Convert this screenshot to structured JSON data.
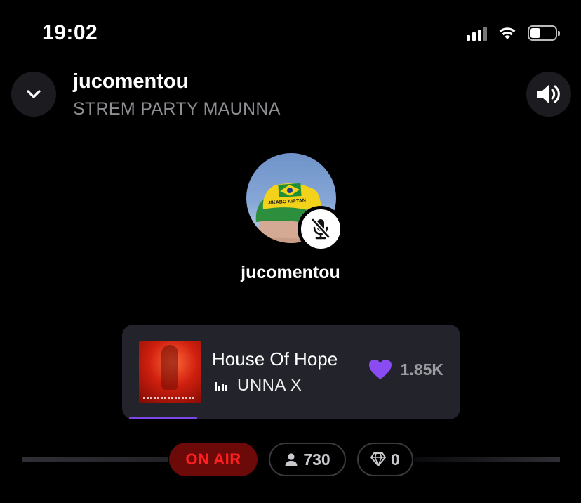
{
  "status_bar": {
    "time": "19:02",
    "icons": [
      "signal-icon",
      "wifi-icon",
      "battery-icon"
    ]
  },
  "header": {
    "collapse_icon": "chevron-down-icon",
    "title": "jucomentou",
    "subtitle": "STREM PARTY MAUNNA",
    "volume_icon": "speaker-icon"
  },
  "host": {
    "name": "jucomentou",
    "mic_status_icon": "mic-muted-icon",
    "cap_text": "JIKABO AIRTAN"
  },
  "now_playing": {
    "title": "House Of Hope",
    "artist": "UNNA X",
    "likes": "1.85K",
    "like_icon": "heart-icon",
    "playing_icon": "equalizer-icon",
    "progress": 0.21
  },
  "footer": {
    "on_air_label": "ON AIR",
    "listener_count": "730",
    "listener_icon": "person-icon",
    "gem_count": "0",
    "gem_icon": "diamond-icon"
  },
  "colors": {
    "background": "#000000",
    "card": "#23232b",
    "accent_purple": "#7b46e6",
    "on_air_red": "#ff1f1f",
    "on_air_bg": "#6c0a0a",
    "muted_text": "#8e8e93"
  }
}
